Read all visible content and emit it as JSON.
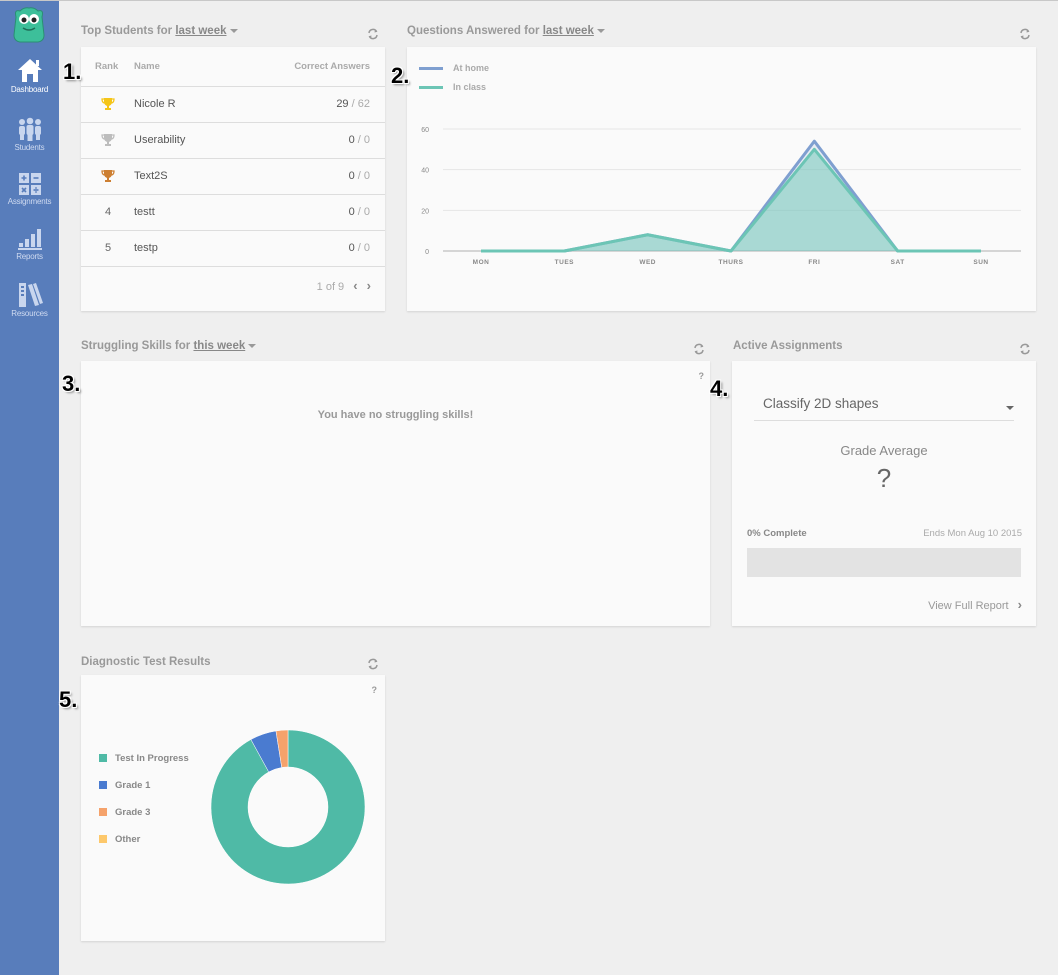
{
  "sidebar": {
    "logo": "monster-logo",
    "items": [
      {
        "label": "Dashboard",
        "icon": "home-icon",
        "active": true
      },
      {
        "label": "Students",
        "icon": "students-icon",
        "active": false
      },
      {
        "label": "Assignments",
        "icon": "calculator-icon",
        "active": false
      },
      {
        "label": "Reports",
        "icon": "bar-chart-icon",
        "active": false
      },
      {
        "label": "Resources",
        "icon": "books-icon",
        "active": false
      }
    ]
  },
  "annotations": [
    "1.",
    "2.",
    "3.",
    "4.",
    "5."
  ],
  "top_students": {
    "title_prefix": "Top Students for",
    "period": "last week",
    "columns": {
      "rank": "Rank",
      "name": "Name",
      "correct": "Correct Answers"
    },
    "rows": [
      {
        "rank": "",
        "trophy": "gold",
        "name": "Nicole R",
        "correct": "29",
        "total": "62"
      },
      {
        "rank": "",
        "trophy": "silver",
        "name": "Userability",
        "correct": "0",
        "total": "0"
      },
      {
        "rank": "",
        "trophy": "bronze",
        "name": "Text2S",
        "correct": "0",
        "total": "0"
      },
      {
        "rank": "4",
        "trophy": null,
        "name": "testt",
        "correct": "0",
        "total": "0"
      },
      {
        "rank": "5",
        "trophy": null,
        "name": "testp",
        "correct": "0",
        "total": "0"
      }
    ],
    "pager": "1 of 9",
    "trophy_colors": {
      "gold": "#f5c518",
      "silver": "#bdbdbd",
      "bronze": "#cd7f32"
    }
  },
  "questions_answered": {
    "title_prefix": "Questions Answered for",
    "period": "last week"
  },
  "chart_data": {
    "type": "area",
    "title": "Questions Answered for last week",
    "categories": [
      "MON",
      "TUES",
      "WED",
      "THURS",
      "FRI",
      "SAT",
      "SUN"
    ],
    "series": [
      {
        "name": "At home",
        "color": "#7f9fd0",
        "values": [
          0,
          0,
          8,
          0,
          54,
          0,
          0
        ]
      },
      {
        "name": "In class",
        "color": "#6cc5b5",
        "values": [
          0,
          0,
          8,
          0,
          50,
          0,
          0
        ]
      }
    ],
    "yticks": [
      0,
      20,
      40,
      60
    ],
    "ylim": [
      0,
      60
    ],
    "grid": true,
    "legend": "top-left",
    "xlabel": "",
    "ylabel": ""
  },
  "struggling_skills": {
    "title_prefix": "Struggling Skills for",
    "period": "this week",
    "empty_message": "You have no struggling skills!",
    "help": "?"
  },
  "active_assignments": {
    "title": "Active Assignments",
    "selected_assignment": "Classify 2D shapes",
    "grade_average_label": "Grade Average",
    "grade_average_value": "?",
    "complete_label": "0% Complete",
    "complete_fraction": 0,
    "ends_label": "Ends Mon Aug 10 2015",
    "view_report": "View Full Report"
  },
  "diagnostic": {
    "title": "Diagnostic Test Results",
    "help": "?",
    "chart": {
      "type": "pie",
      "donut": true,
      "slices": [
        {
          "label": "Test In Progress",
          "value": 92,
          "color": "#4fbaa6"
        },
        {
          "label": "Grade 1",
          "value": 5.5,
          "color": "#4a7bd0"
        },
        {
          "label": "Grade 3",
          "value": 2.5,
          "color": "#f5a26b"
        },
        {
          "label": "Other",
          "value": 0,
          "color": "#fdc86b"
        }
      ]
    }
  }
}
